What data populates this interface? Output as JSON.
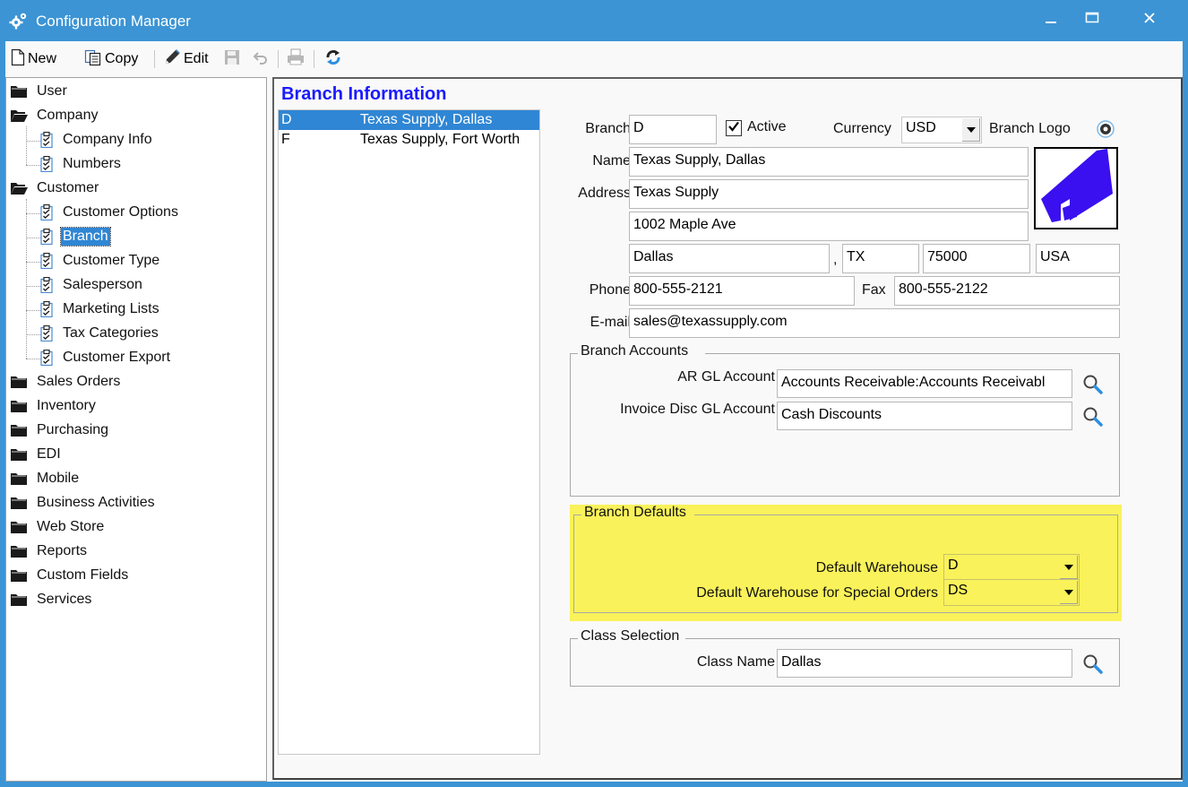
{
  "window": {
    "title": "Configuration Manager",
    "controls": {
      "minimize": "minimize",
      "maximize": "maximize",
      "close": "close"
    }
  },
  "toolbar": {
    "new_label": "New",
    "copy_label": "Copy",
    "edit_label": "Edit",
    "save_icon": "save-icon",
    "undo_icon": "undo-icon",
    "print_icon": "print-icon",
    "refresh_icon": "refresh-icon"
  },
  "tree": {
    "items": [
      {
        "label": "User",
        "type": "folder",
        "expanded": false
      },
      {
        "label": "Company",
        "type": "folder",
        "expanded": true
      },
      {
        "label": "Company Info",
        "type": "doc"
      },
      {
        "label": "Numbers",
        "type": "doc"
      },
      {
        "label": "Customer",
        "type": "folder",
        "expanded": true
      },
      {
        "label": "Customer Options",
        "type": "doc"
      },
      {
        "label": "Branch",
        "type": "doc",
        "selected": true
      },
      {
        "label": "Customer Type",
        "type": "doc"
      },
      {
        "label": "Salesperson",
        "type": "doc"
      },
      {
        "label": "Marketing Lists",
        "type": "doc"
      },
      {
        "label": "Tax Categories",
        "type": "doc"
      },
      {
        "label": "Customer Export",
        "type": "doc"
      },
      {
        "label": "Sales Orders",
        "type": "folder",
        "expanded": false
      },
      {
        "label": "Inventory",
        "type": "folder",
        "expanded": false
      },
      {
        "label": "Purchasing",
        "type": "folder",
        "expanded": false
      },
      {
        "label": "EDI",
        "type": "folder",
        "expanded": false
      },
      {
        "label": "Mobile",
        "type": "folder",
        "expanded": false
      },
      {
        "label": "Business Activities",
        "type": "folder",
        "expanded": false
      },
      {
        "label": "Web Store",
        "type": "folder",
        "expanded": false
      },
      {
        "label": "Reports",
        "type": "folder",
        "expanded": false
      },
      {
        "label": "Custom Fields",
        "type": "folder",
        "expanded": false
      },
      {
        "label": "Services",
        "type": "folder",
        "expanded": false
      }
    ]
  },
  "main": {
    "title": "Branch Information",
    "branches": [
      {
        "code": "D",
        "name": "Texas Supply, Dallas",
        "selected": true
      },
      {
        "code": "F",
        "name": "Texas Supply, Fort Worth",
        "selected": false
      }
    ]
  },
  "form": {
    "branch_label": "Branch",
    "branch_value": "D",
    "active_label": "Active",
    "active_checked": true,
    "currency_label": "Currency",
    "currency_value": "USD",
    "logo_label": "Branch Logo",
    "name_label": "Name",
    "name_value": "Texas Supply, Dallas",
    "address_label": "Address",
    "address1": "Texas Supply",
    "address2": "1002 Maple Ave",
    "city": "Dallas",
    "comma": ",",
    "state": "TX",
    "zip": "75000",
    "country": "USA",
    "phone_label": "Phone",
    "phone_value": "800-555-2121",
    "fax_label": "Fax",
    "fax_value": "800-555-2122",
    "email_label": "E-mail",
    "email_value": "sales@texassupply.com"
  },
  "accounts": {
    "title": "Branch Accounts",
    "ar_label": "AR GL Account",
    "ar_value": "Accounts Receivable:Accounts Receivabl",
    "disc_label": "Invoice Disc GL Account",
    "disc_value": "Cash Discounts"
  },
  "defaults": {
    "title": "Branch Defaults",
    "highlight_color": "#f9f25a",
    "warehouse_label": "Default Warehouse",
    "warehouse_value": "D",
    "special_label": "Default Warehouse for Special Orders",
    "special_value": "DS"
  },
  "class_selection": {
    "title": "Class Selection",
    "class_label": "Class Name",
    "class_value": "Dallas"
  },
  "colors": {
    "titlebar": "#3c94d4",
    "selection": "#2f86d4",
    "heading": "#1a1aff",
    "logo": "#3a10f0"
  }
}
